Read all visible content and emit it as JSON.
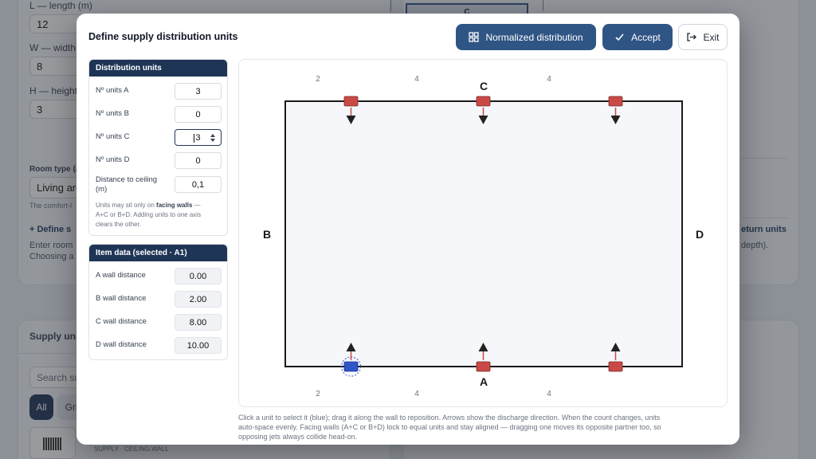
{
  "background": {
    "length_label": "L — length (m)",
    "length_value": "12",
    "width_label": "W — width",
    "width_value": "8",
    "height_label": "H — height",
    "height_value": "3",
    "room_type_label": "Room type (a",
    "room_type_value": "Living are",
    "comfort_note": "The comfort-l",
    "define_link": "+ Define s",
    "enter_text": "Enter room",
    "choosing_text": "Choosing a",
    "return_link": "eturn units",
    "depth_text": "depth).",
    "supply_title": "Supply unit",
    "search_placeholder": "Search su",
    "filter_all": "All",
    "filter_grille": "Gril",
    "item_meta": "SUPPLY · CEILING,WALL",
    "thumb_label": "C"
  },
  "modal": {
    "title": "Define supply distribution units",
    "normalized_button": "Normalized distribution",
    "accept_button": "Accept",
    "exit_button": "Exit"
  },
  "distribution": {
    "header": "Distribution units",
    "units_a_label": "Nº units A",
    "units_a_value": "3",
    "units_b_label": "Nº units B",
    "units_b_value": "0",
    "units_c_label": "Nº units C",
    "units_c_value": "3",
    "units_d_label": "Nº units D",
    "units_d_value": "0",
    "ceiling_label_1": "Distance to ceiling",
    "ceiling_label_2": "(m)",
    "ceiling_value": "0,1",
    "note_1": "Units may sit only on",
    "note_bold": "facing walls",
    "note_2": " —",
    "note_3": "A+C or B+D. Adding units to one axis",
    "note_4": "clears the other."
  },
  "item": {
    "header": "Item data (selected · A1)",
    "a_label": "A wall distance",
    "a_value": "0.00",
    "b_label": "B wall distance",
    "b_value": "2.00",
    "c_label": "C wall distance",
    "c_value": "8.00",
    "d_label": "D wall distance",
    "d_value": "10.00"
  },
  "plan": {
    "wall_a": "A",
    "wall_b": "B",
    "wall_c": "C",
    "wall_d": "D",
    "top_spacing": [
      "2",
      "4",
      "4"
    ],
    "bottom_spacing": [
      "2",
      "4",
      "4"
    ],
    "unit_color": "#c94a45",
    "selected_color": "#2f55c8",
    "wall_color": "#1a1a1a",
    "room_fill": "#f5f7fb"
  },
  "footer": {
    "line1": "Click a unit to select it (blue); drag it along the wall to reposition. Arrows show the discharge direction. When the count changes, units",
    "line2": "auto-space evenly. Facing walls (A+C or B+D) lock to equal units and stay aligned — dragging one moves its opposite partner too, so",
    "line3": "opposing jets always collide head-on."
  }
}
